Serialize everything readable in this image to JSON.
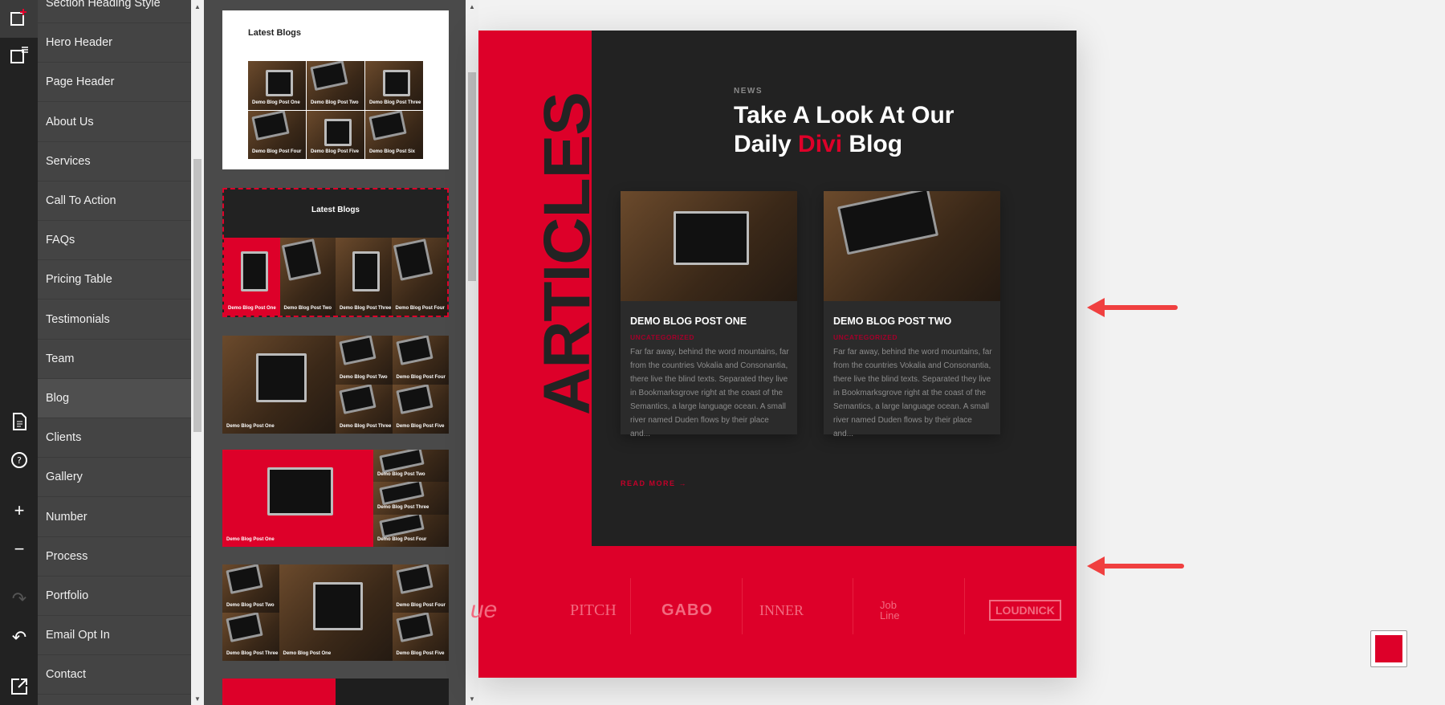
{
  "sidebar": {
    "icons": [
      "add-section-icon",
      "layouts-icon",
      "page-icon",
      "help-icon",
      "zoom-in-icon",
      "zoom-out-icon",
      "redo-icon",
      "undo-icon",
      "export-icon"
    ],
    "items": [
      {
        "label": "Section Heading Style"
      },
      {
        "label": "Hero Header"
      },
      {
        "label": "Page Header"
      },
      {
        "label": "About Us"
      },
      {
        "label": "Services"
      },
      {
        "label": "Call To Action"
      },
      {
        "label": "FAQs"
      },
      {
        "label": "Pricing Table"
      },
      {
        "label": "Testimonials"
      },
      {
        "label": "Team"
      },
      {
        "label": "Blog",
        "selected": true
      },
      {
        "label": "Clients"
      },
      {
        "label": "Gallery"
      },
      {
        "label": "Number"
      },
      {
        "label": "Process"
      },
      {
        "label": "Portfolio"
      },
      {
        "label": "Email Opt In"
      },
      {
        "label": "Contact"
      }
    ]
  },
  "thumbnails": {
    "t1": {
      "title": "Latest Blogs",
      "posts": [
        "Demo Blog Post One",
        "Demo Blog Post Two",
        "Demo Blog Post Three",
        "Demo Blog Post Four",
        "Demo Blog Post Five",
        "Demo Blog Post Six"
      ]
    },
    "t2": {
      "title": "Latest Blogs",
      "posts": [
        "Demo Blog Post One",
        "Demo Blog Post Two",
        "Demo Blog Post Three",
        "Demo Blog Post Four"
      ]
    },
    "t3": {
      "main": "Demo Blog Post One",
      "posts": [
        "Demo Blog Post Two",
        "Demo Blog Post Four",
        "Demo Blog Post Three",
        "Demo Blog Post Five"
      ]
    },
    "t4": {
      "main": "Demo Blog Post One",
      "posts": [
        "Demo Blog Post Two",
        "Demo Blog Post Three",
        "Demo Blog Post Four"
      ]
    },
    "t5": {
      "main": "Demo Blog Post One",
      "posts": [
        "Demo Blog Post Two",
        "Demo Blog Post Three",
        "Demo Blog Post Four",
        "Demo Blog Post Five"
      ]
    }
  },
  "preview": {
    "vertical_text": "ARTICLES",
    "eyebrow": "NEWS",
    "title_line1": "Take A Look At Our",
    "title_pre": "Daily ",
    "title_accent": "Divi",
    "title_post": " Blog",
    "posts": [
      {
        "title": "DEMO BLOG POST ONE",
        "category": "UNCATEGORIZED",
        "excerpt": "Far far away, behind the word mountains, far from the countries Vokalia and Consonantia, there live the blind texts. Separated they live in Bookmarksgrove right at the coast of the Semantics, a large language ocean. A small river named Duden flows by their place and..."
      },
      {
        "title": "DEMO BLOG POST TWO",
        "category": "UNCATEGORIZED",
        "excerpt": "Far far away, behind the word mountains, far from the countries Vokalia and Consonantia, there live the blind texts. Separated they live in Bookmarksgrove right at the coast of the Semantics, a large language ocean. A small river named Duden flows by their place and..."
      }
    ],
    "read_more": "READ MORE →",
    "logos": [
      "ue",
      "PITCH",
      "GABO",
      "INNER",
      "Job Line",
      "LOUDNICK"
    ]
  },
  "colors": {
    "accent": "#dd0029",
    "dark": "#222222",
    "swatch": "#dd0029",
    "annotation_arrow": "#f04040"
  }
}
